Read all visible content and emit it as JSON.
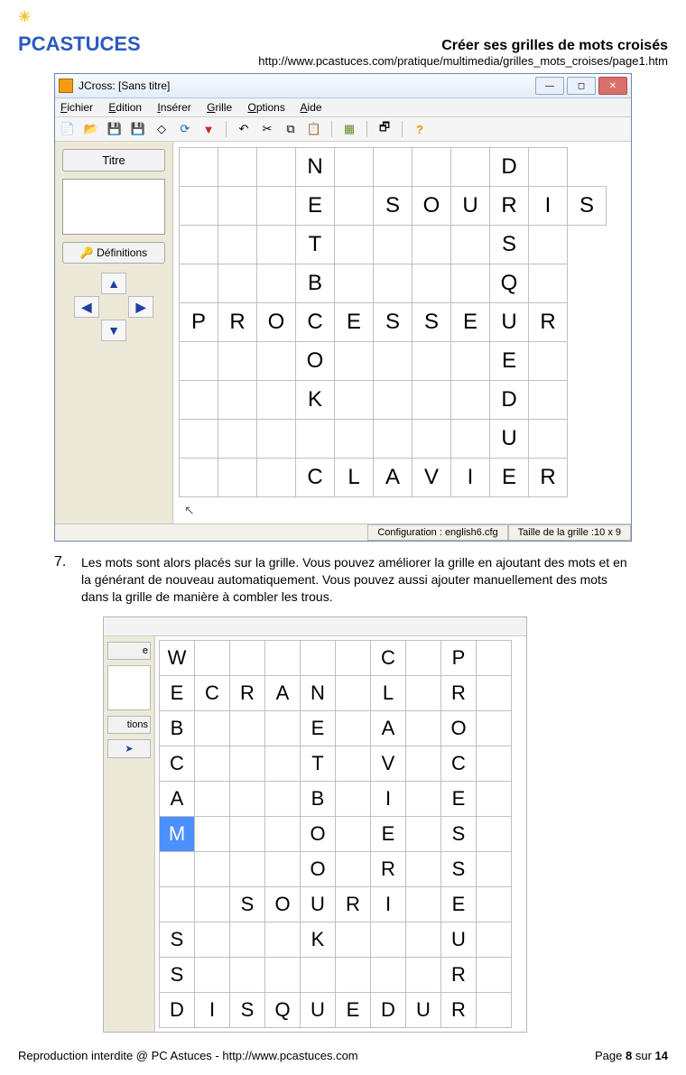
{
  "header": {
    "logo_pc": "PC",
    "logo_ast": "ASTUCES",
    "title": "Créer ses grilles de mots croisés",
    "url": "http://www.pcastuces.com/pratique/multimedia/grilles_mots_croises/page1.htm"
  },
  "window1": {
    "title": "JCross: [Sans titre]",
    "menu": [
      "Fichier",
      "Edition",
      "Insérer",
      "Grille",
      "Options",
      "Aide"
    ],
    "side": {
      "titre_btn": "Titre",
      "def_btn": "Définitions"
    },
    "status": {
      "config": "Configuration : english6.cfg",
      "size": "Taille de la grille :10 x 9"
    },
    "grid": [
      [
        "",
        "",
        "",
        "N",
        "",
        "",
        "",
        "",
        "D",
        ""
      ],
      [
        "",
        "",
        "",
        "E",
        "",
        "S",
        "O",
        "U",
        "R",
        "I",
        "S"
      ],
      [
        "",
        "",
        "",
        "T",
        "",
        "",
        "",
        "",
        "S",
        ""
      ],
      [
        "",
        "",
        "",
        "B",
        "",
        "",
        "",
        "",
        "Q",
        ""
      ],
      [
        "P",
        "R",
        "O",
        "C",
        "E",
        "S",
        "S",
        "E",
        "U",
        "R"
      ],
      [
        "",
        "",
        "",
        "O",
        "",
        "",
        "",
        "",
        "E",
        ""
      ],
      [
        "",
        "",
        "",
        "K",
        "",
        "",
        "",
        "",
        "D",
        ""
      ],
      [
        "",
        "",
        "",
        "",
        "",
        "",
        "",
        "",
        "U",
        ""
      ],
      [
        "",
        "",
        "",
        "C",
        "L",
        "A",
        "V",
        "I",
        "E",
        "R"
      ]
    ]
  },
  "step": {
    "num": "7.",
    "text": "Les mots sont alors placés sur la grille. Vous pouvez améliorer la grille en ajoutant des mots et en la générant de nouveau automatiquement. Vous pouvez aussi ajouter manuellement des mots dans la grille de manière à combler les trous."
  },
  "window2": {
    "side_labels": [
      "e",
      "",
      "tions",
      "➤"
    ],
    "grid": [
      [
        "W",
        "",
        "",
        "",
        "",
        "",
        "C",
        "",
        "P",
        ""
      ],
      [
        "E",
        "C",
        "R",
        "A",
        "N",
        "",
        "L",
        "",
        "R",
        ""
      ],
      [
        "B",
        "",
        "",
        "",
        "E",
        "",
        "A",
        "",
        "O",
        ""
      ],
      [
        "C",
        "",
        "",
        "",
        "T",
        "",
        "V",
        "",
        "C",
        ""
      ],
      [
        "A",
        "",
        "",
        "",
        "B",
        "",
        "I",
        "",
        "E",
        ""
      ],
      [
        "M",
        "",
        "",
        "",
        "O",
        "",
        "E",
        "",
        "S",
        ""
      ],
      [
        "",
        "",
        "",
        "",
        "O",
        "",
        "R",
        "",
        "S",
        ""
      ],
      [
        "",
        "",
        "S",
        "O",
        "U",
        "R",
        "I",
        "",
        "E",
        ""
      ],
      [
        "S",
        "",
        "",
        "",
        "K",
        "",
        "",
        "",
        "U",
        ""
      ],
      [
        "S",
        "",
        "",
        "",
        "",
        "",
        "",
        "",
        "R",
        ""
      ],
      [
        "D",
        "I",
        "S",
        "Q",
        "U",
        "E",
        "D",
        "U",
        "R",
        ""
      ]
    ],
    "selected_cell": "M"
  },
  "footer": {
    "left": "Reproduction interdite @ PC Astuces - http://www.pcastuces.com",
    "page_prefix": "Page ",
    "page_num": "8",
    "page_mid": " sur ",
    "page_total": "14"
  }
}
